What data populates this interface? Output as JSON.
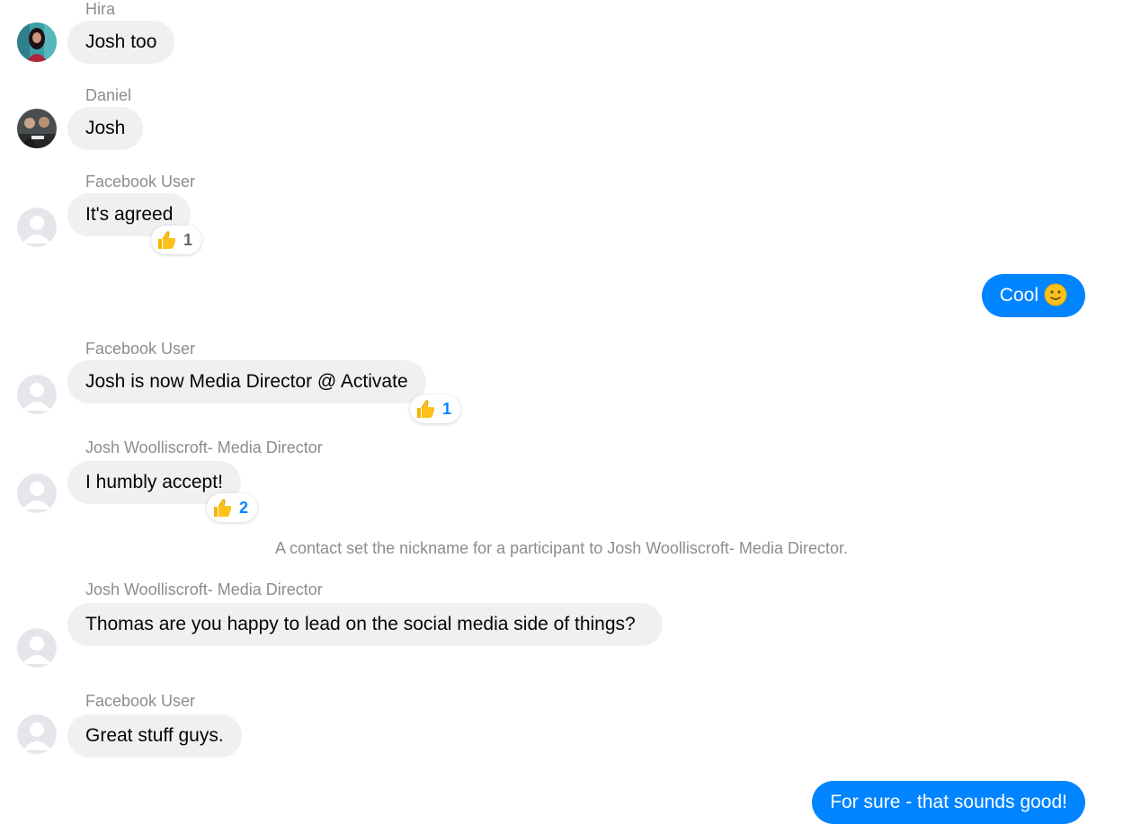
{
  "messages": [
    {
      "sender": "Hira",
      "text": "Josh too"
    },
    {
      "sender": "Daniel",
      "text": "Josh"
    },
    {
      "sender": "Facebook User",
      "text": "It's agreed",
      "reaction": {
        "emoji": "thumbs-up-icon",
        "count": "1"
      }
    },
    {
      "sender": "me",
      "text": "Cool",
      "emoji": "slightly-smiling-face-icon"
    },
    {
      "sender": "Facebook User",
      "text": "Josh is now Media Director @ Activate",
      "reaction": {
        "emoji": "thumbs-up-icon",
        "count": "1"
      }
    },
    {
      "sender": "Josh Woolliscroft- Media Director",
      "text": "I humbly accept!",
      "reaction": {
        "emoji": "thumbs-up-icon",
        "count": "2"
      }
    },
    {
      "sender": "Josh Woolliscroft- Media Director",
      "text": "Thomas are you happy to lead on the social media side of things?"
    },
    {
      "sender": "Facebook User",
      "text": "Great stuff guys."
    },
    {
      "sender": "me",
      "text": "For sure - that sounds good!"
    }
  ],
  "system": {
    "nickname_notice": "A contact set the nickname for a participant to Josh Woolliscroft- Media Director."
  },
  "colors": {
    "outgoing_bubble": "#0084ff",
    "incoming_bubble": "#f0f0f0",
    "sender_name": "#8a8d91"
  }
}
